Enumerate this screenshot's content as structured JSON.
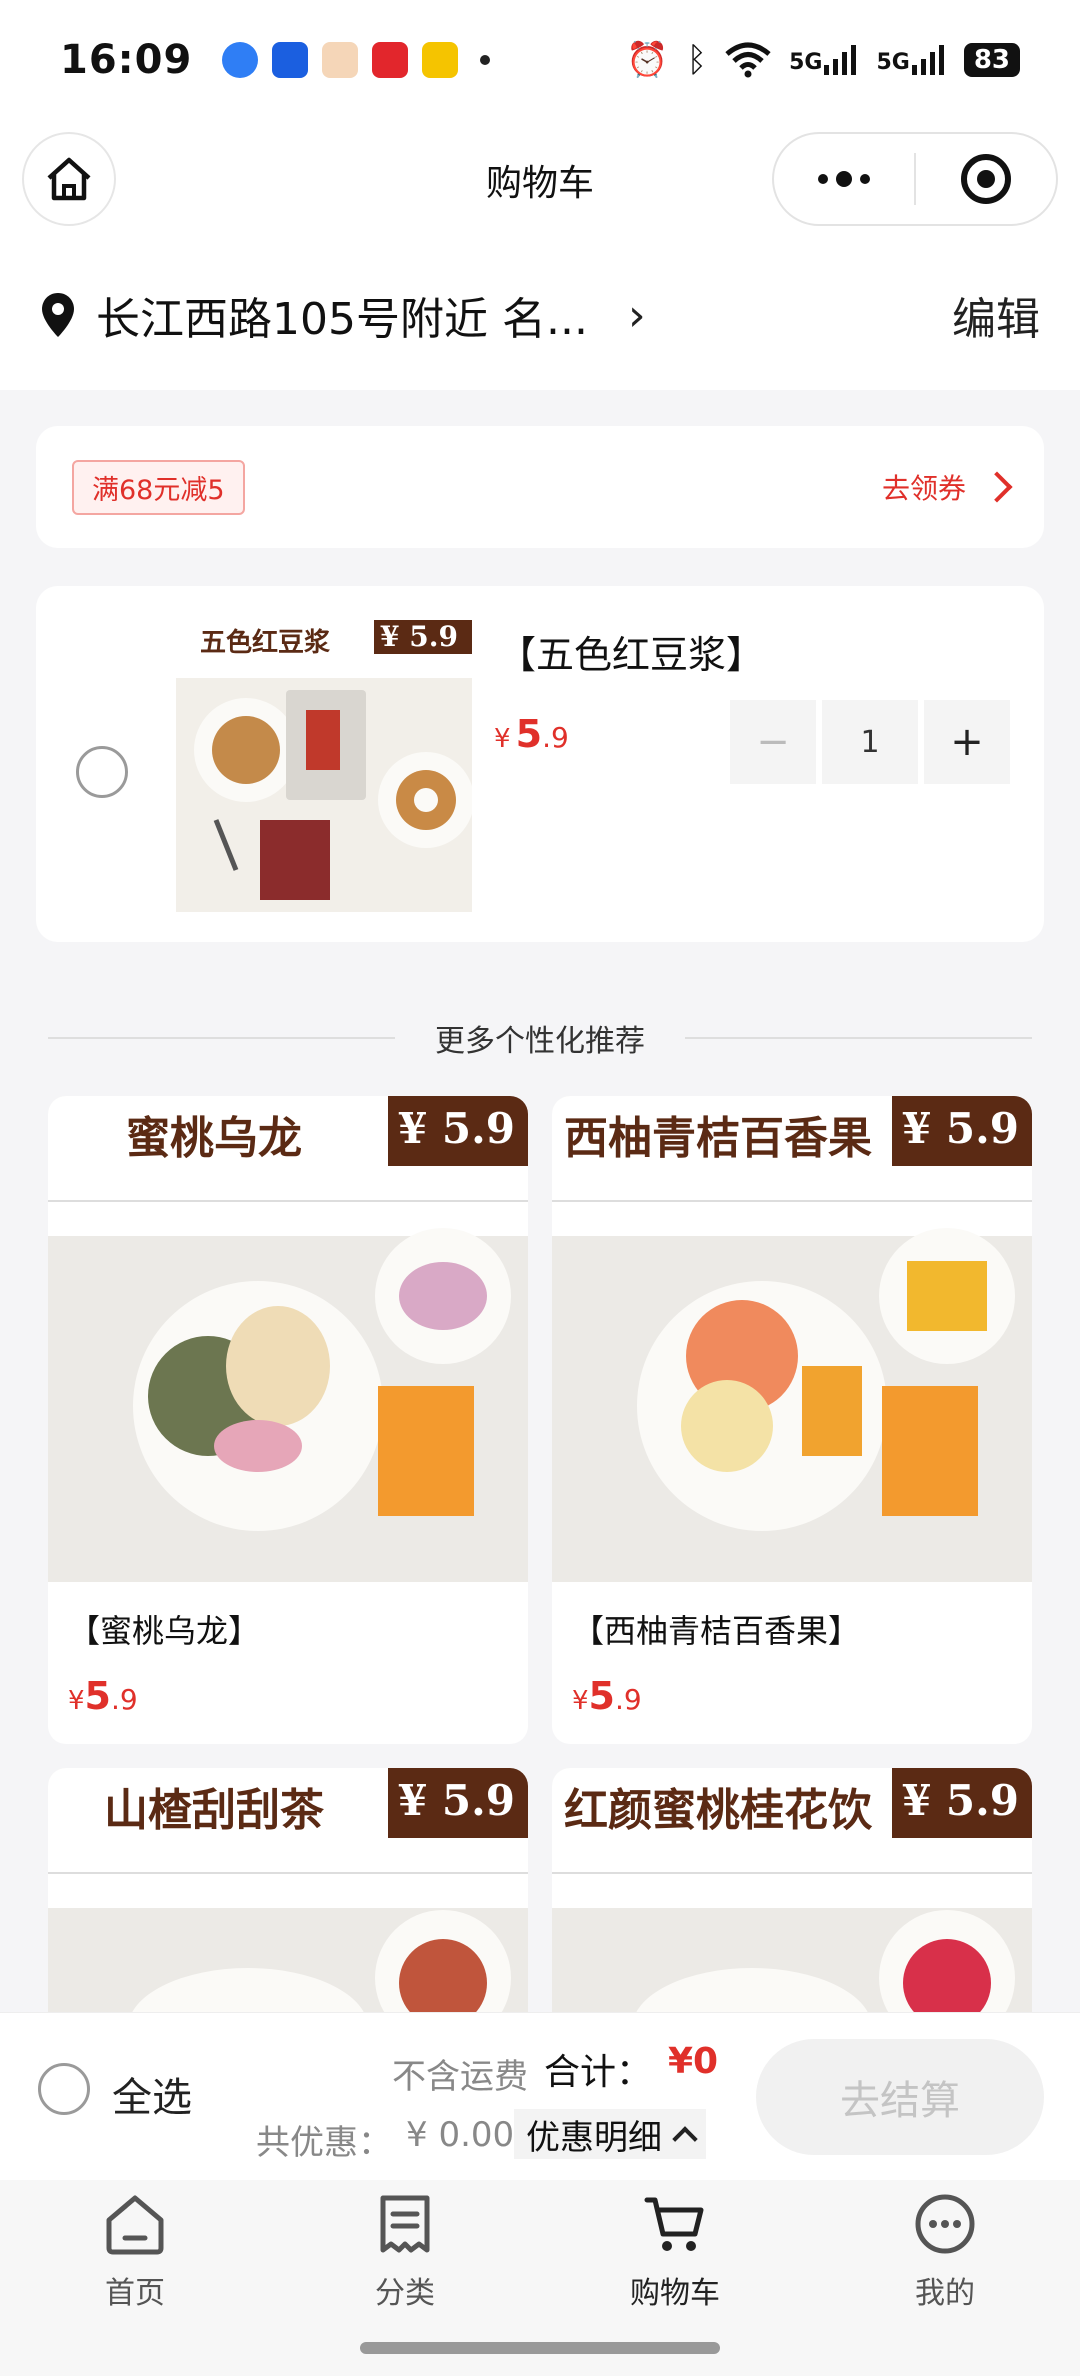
{
  "status_bar": {
    "time": "16:09",
    "network_1": "5G",
    "network_2": "5G",
    "battery": "83"
  },
  "title_bar": {
    "title": "购物车"
  },
  "address": {
    "text": "长江西路105号附近 名...",
    "edit_label": "编辑"
  },
  "coupon": {
    "tag": "满68元减5",
    "link_label": "去领券"
  },
  "cart_item": {
    "name": "【五色红豆浆】",
    "price_symbol": "¥",
    "price_int": "5",
    "price_dec": ".9",
    "quantity": "1",
    "minus": "−",
    "plus": "+",
    "image_title": "五色红豆浆",
    "image_price": "¥ 5.9"
  },
  "recommend": {
    "title": "更多个性化推荐",
    "products": [
      {
        "name": "【蜜桃乌龙】",
        "price_int": "5",
        "price_dec": ".9",
        "image_title": "蜜桃乌龙",
        "image_price": "¥ 5.9"
      },
      {
        "name": "【西柚青桔百香果】",
        "price_int": "5",
        "price_dec": ".9",
        "image_title": "西柚青桔百香果",
        "image_price": "¥ 5.9"
      },
      {
        "name": "",
        "price_int": "",
        "price_dec": "",
        "image_title": "山楂刮刮茶",
        "image_price": "¥ 5.9"
      },
      {
        "name": "",
        "price_int": "",
        "price_dec": "",
        "image_title": "红颜蜜桃桂花饮",
        "image_price": "¥ 5.9"
      }
    ]
  },
  "bottom_bar": {
    "select_all": "全选",
    "no_shipping": "不含运费",
    "total_label": "合计：",
    "total_value": "¥0",
    "savings_label": "共优惠：",
    "savings_value": "¥ 0.00",
    "detail_label": "优惠明细",
    "checkout_label": "去结算"
  },
  "tabs": [
    {
      "label": "首页",
      "icon": "home-icon"
    },
    {
      "label": "分类",
      "icon": "category-icon"
    },
    {
      "label": "购物车",
      "icon": "cart-icon"
    },
    {
      "label": "我的",
      "icon": "profile-icon"
    }
  ],
  "colors": {
    "accent_red": "#e0302a",
    "brand_brown": "#5b2a14"
  }
}
